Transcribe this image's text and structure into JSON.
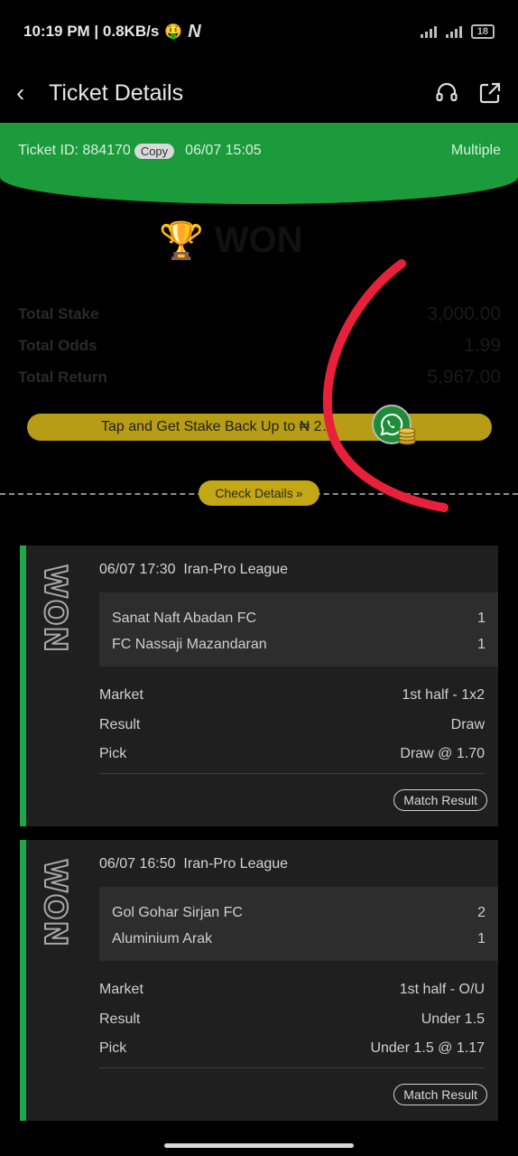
{
  "status_bar": {
    "time_speed": "10:19 PM | 0.8KB/s",
    "emoji_icon": "money-face-emoji",
    "app_badge": "N",
    "battery": "18"
  },
  "header": {
    "title": "Ticket Details",
    "back_icon": "chevron-left-icon",
    "support_icon": "headset-icon",
    "share_icon": "share-icon"
  },
  "ticket": {
    "id_label": "Ticket ID: 884170",
    "copy_label": "Copy",
    "date": "06/07 15:05",
    "type": "Multiple"
  },
  "result": {
    "status": "WON",
    "icon": "trophy-icon"
  },
  "totals": [
    {
      "label": "Total Stake",
      "value": "3,000.00"
    },
    {
      "label": "Total Odds",
      "value": "1.99"
    },
    {
      "label": "Total Return",
      "value": "5,967.00"
    }
  ],
  "promo": {
    "text": "Tap and Get Stake Back Up to ₦ 2…"
  },
  "check_details": "Check Details",
  "bets": [
    {
      "status": "WON",
      "datetime": "06/07 17:30",
      "league": "Iran-Pro League",
      "teams": [
        {
          "name": "Sanat Naft Abadan FC",
          "score": "1"
        },
        {
          "name": "FC Nassaji Mazandaran",
          "score": "1"
        }
      ],
      "market_label": "Market",
      "market": "1st half - 1x2",
      "result_label": "Result",
      "result": "Draw",
      "pick_label": "Pick",
      "pick": "Draw @ 1.70",
      "button": "Match Result"
    },
    {
      "status": "WON",
      "datetime": "06/07 16:50",
      "league": "Iran-Pro League",
      "teams": [
        {
          "name": "Gol Gohar Sirjan FC",
          "score": "2"
        },
        {
          "name": "Aluminium Arak",
          "score": "1"
        }
      ],
      "market_label": "Market",
      "market": "1st half - O/U",
      "result_label": "Result",
      "result": "Under 1.5",
      "pick_label": "Pick",
      "pick": "Under 1.5 @ 1.17",
      "button": "Match Result"
    }
  ],
  "colors": {
    "green": "#1b9b3c",
    "gold": "#c4a715",
    "annotation_red": "#e8213a"
  }
}
